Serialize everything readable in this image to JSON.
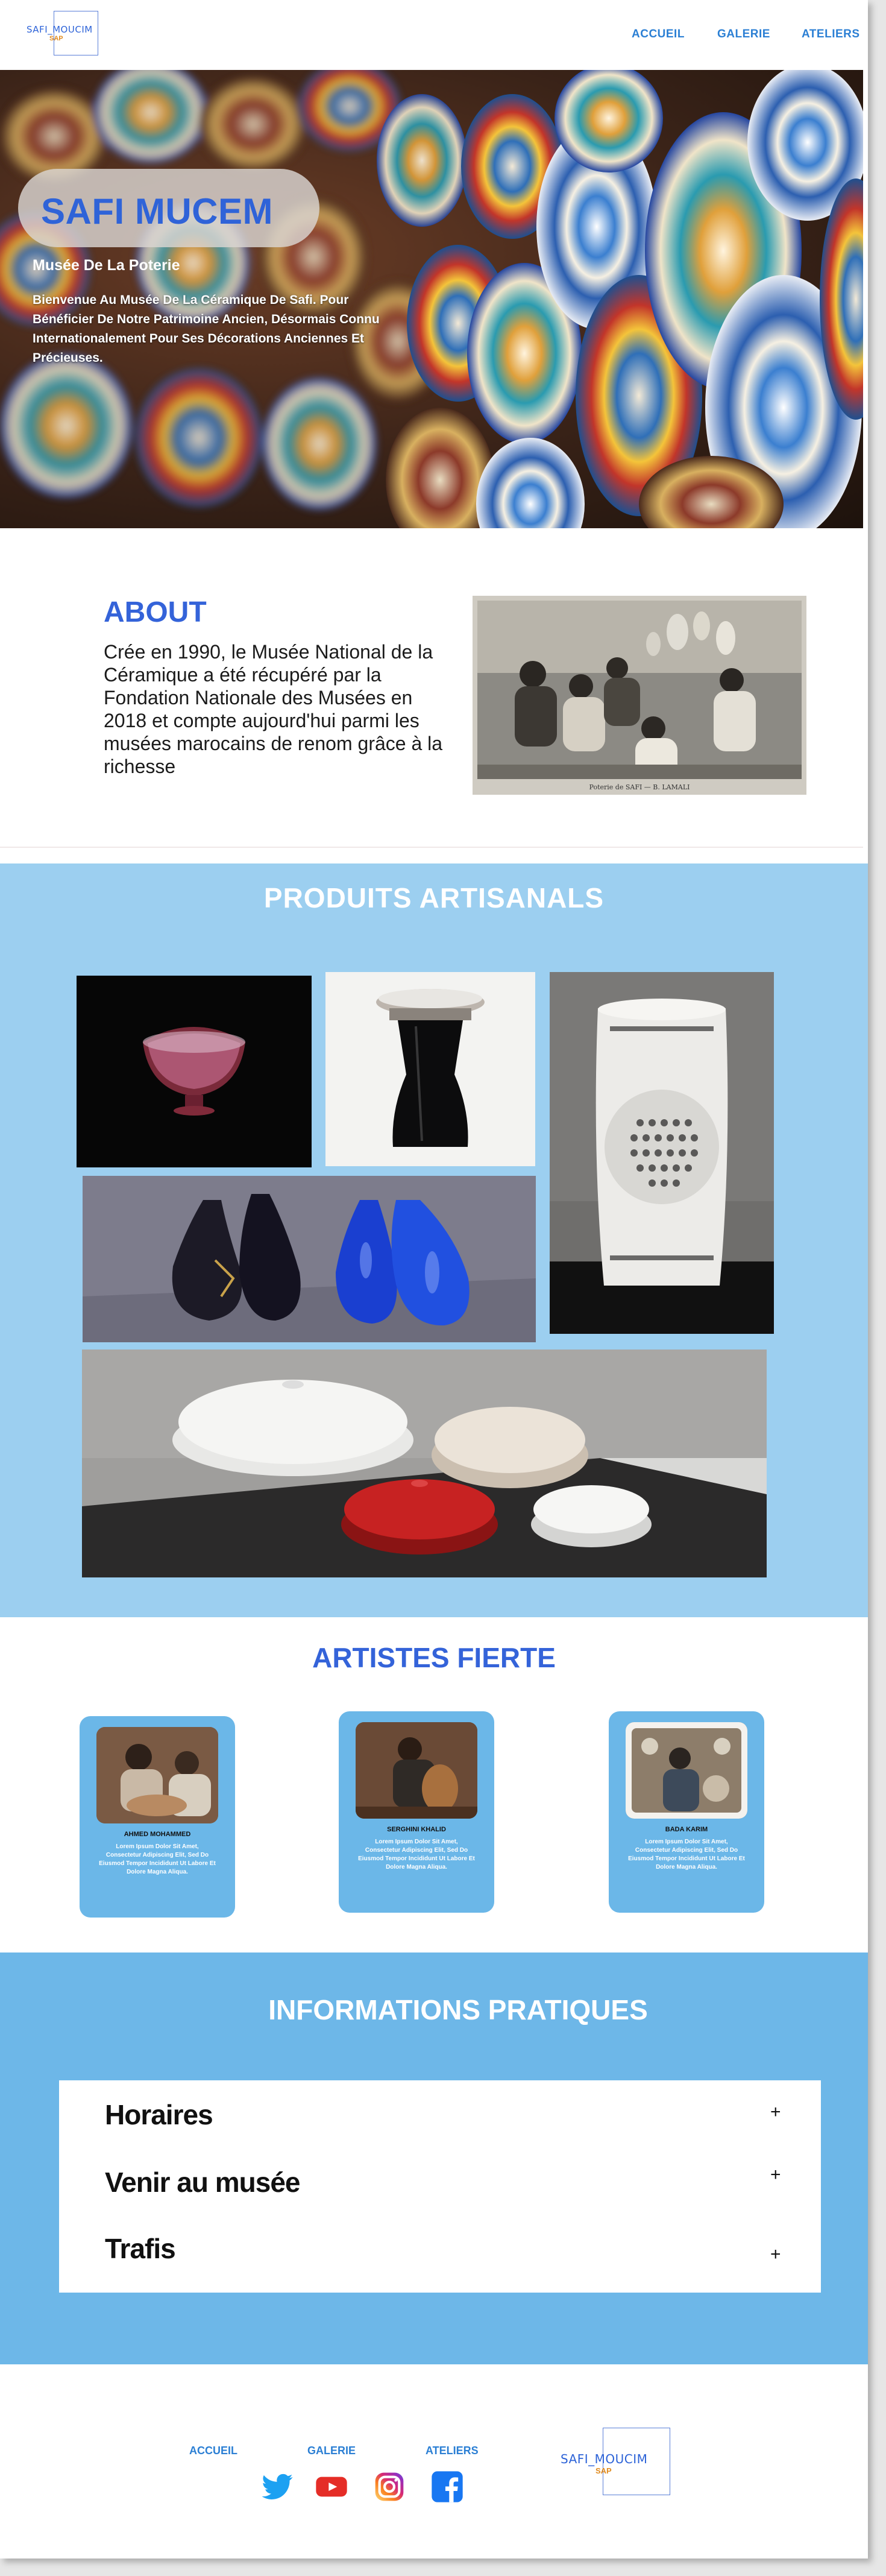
{
  "nav": {
    "logo_text": "SAFI_MOUCIM",
    "logo_sub": "SAP",
    "links": [
      "ACCUEIL",
      "GALERIE",
      "ATELIERS"
    ]
  },
  "hero": {
    "title": "SAFI MUCEM",
    "subtitle": "Musée De La Poterie",
    "intro": "Bienvenue Au Musée De La Céramique De Safi. Pour Bénéficier De Notre Patrimoine Ancien, Désormais Connu Internationalement Pour Ses Décorations Anciennes Et Précieuses."
  },
  "about": {
    "title": "ABOUT",
    "text": "Crée en 1990, le Musée National de la Céramique a été récupéré par la Fondation Nationale des Musées en 2018 et compte aujourd'hui parmi les musées marocains de renom grâce à la richesse",
    "photo_caption": "Poterie de SAFI — B. LAMALI"
  },
  "produits": {
    "title": "PRODUITS  ARTISANALS"
  },
  "artistes": {
    "title": "ARTISTES FIERTE",
    "cards": [
      {
        "name": "AHMED MOHAMMED",
        "desc": "Lorem Ipsum Dolor Sit Amet, Consectetur Adipiscing Elit, Sed Do Eiusmod Tempor Incididunt Ut Labore Et Dolore Magna Aliqua."
      },
      {
        "name": "SERGHINI KHALID",
        "desc": "Lorem Ipsum Dolor Sit Amet, Consectetur Adipiscing Elit, Sed Do Eiusmod Tempor Incididunt Ut Labore Et Dolore Magna Aliqua."
      },
      {
        "name": "BADA KARIM",
        "desc": "Lorem Ipsum Dolor Sit Amet, Consectetur Adipiscing Elit, Sed Do Eiusmod Tempor Incididunt Ut Labore Et Dolore Magna Aliqua."
      }
    ]
  },
  "info": {
    "title": "INFORMATIONS PRATIQUES",
    "items": [
      "Horaires",
      "Venir au musée",
      "Trafis"
    ],
    "toggle": "+"
  },
  "footer": {
    "links": [
      "ACCUEIL",
      "GALERIE",
      "ATELIERS"
    ],
    "socials": [
      "twitter-icon",
      "youtube-icon",
      "instagram-icon",
      "facebook-icon"
    ],
    "logo_text": "SAFI_MOUCIM",
    "logo_sub": "SAP"
  },
  "colors": {
    "primary_blue": "#3463d9",
    "nav_link": "#2b7fd4",
    "section_light_blue": "#9ccff0",
    "section_blue": "#6db7e8"
  }
}
